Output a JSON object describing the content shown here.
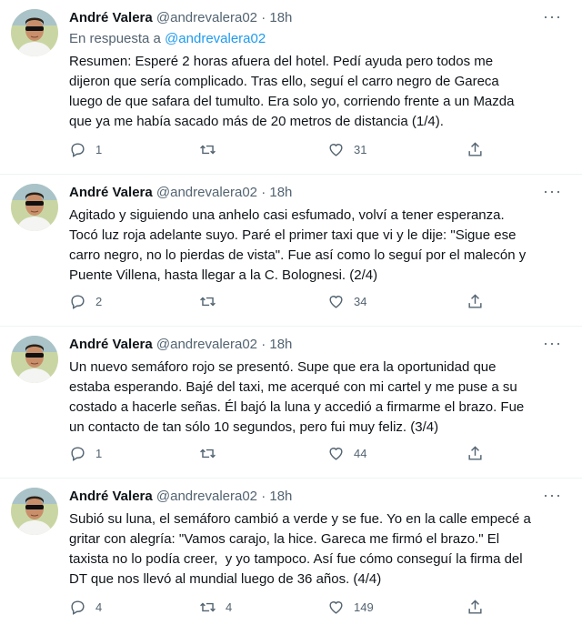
{
  "tweets": [
    {
      "name": "André Valera",
      "handle": "@andrevalera02",
      "time": "18h",
      "reply_prefix": "En respuesta a",
      "reply_handle": "@andrevalera02",
      "text": "Resumen: Esperé 2 horas afuera del hotel. Pedí ayuda pero todos me\ndijeron que sería complicado. Tras ello, seguí el carro negro de Gareca\nluego de que safara del tumulto. Era solo yo, corriendo frente a un Mazda\nque ya me había sacado más de 20 metros de distancia (1/4).",
      "replies": "1",
      "retweets": "",
      "likes": "31"
    },
    {
      "name": "André Valera",
      "handle": "@andrevalera02",
      "time": "18h",
      "text": "Agitado y siguiendo una anhelo casi esfumado, volví a tener esperanza.\nTocó luz roja adelante suyo. Paré el primer taxi que vi y le dije: \"Sigue ese\ncarro negro, no lo pierdas de vista\". Fue así como lo seguí por el malecón y\nPuente Villena, hasta llegar a la C. Bolognesi. (2/4)",
      "replies": "2",
      "retweets": "",
      "likes": "34"
    },
    {
      "name": "André Valera",
      "handle": "@andrevalera02",
      "time": "18h",
      "text": "Un nuevo semáforo rojo se presentó. Supe que era la oportunidad que\nestaba esperando. Bajé del taxi, me acerqué con mi cartel y me puse a su\ncostado a hacerle señas. Él bajó la luna y accedió a firmarme el brazo. Fue\nun contacto de tan sólo 10 segundos, pero fui muy feliz. (3/4)",
      "replies": "1",
      "retweets": "",
      "likes": "44"
    },
    {
      "name": "André Valera",
      "handle": "@andrevalera02",
      "time": "18h",
      "text": "Subió su luna, el semáforo cambió a verde y se fue. Yo en la calle empecé a\ngritar con alegría: \"Vamos carajo, la hice. Gareca me firmó el brazo.\" El\ntaxista no lo podía creer,  y yo tampoco. Así fue cómo conseguí la firma del\nDT que nos llevó al mundial luego de 36 años. (4/4)",
      "replies": "4",
      "retweets": "4",
      "likes": "149"
    }
  ],
  "icons": {
    "avatar": "profile-photo",
    "more": "more-dots-icon",
    "reply": "reply-icon",
    "retweet": "retweet-icon",
    "like": "heart-icon",
    "share": "share-icon"
  },
  "colors": {
    "link": "#1d9bf0",
    "muted": "#536471",
    "text": "#0f1419"
  }
}
